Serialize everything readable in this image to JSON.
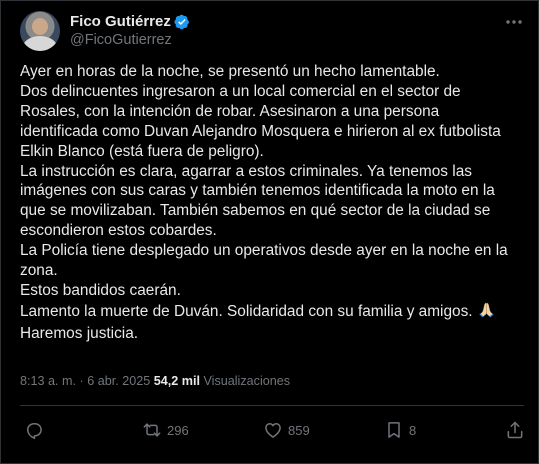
{
  "author": {
    "display_name": "Fico Gutiérrez",
    "handle": "@FicoGutierrez",
    "verified": true,
    "avatar_description": "profile photo"
  },
  "tweet": {
    "text": "Ayer en horas de la noche, se presentó un hecho lamentable.\nDos delincuentes ingresaron a un local comercial en el sector de\nRosales, con la intención de robar. Asesinaron a una persona\nidentificada como Duvan Alejandro Mosquera e hirieron al ex futbolista\nElkin Blanco (está fuera de peligro).\nLa instrucción es clara, agarrar a estos criminales. Ya tenemos las\nimágenes con sus caras y también tenemos identificada la moto en la\nque se movilizaban. También sabemos en qué sector de la ciudad se\nescondieron estos cobardes.\nLa Policía tiene desplegado un operativos desde ayer en la noche en la\nzona.\nEstos bandidos caerán.\nLamento la muerte de Duván. Solidaridad con su familia y amigos.",
    "text_last_line": "Haremos justicia.",
    "emoji": "🙏🏻"
  },
  "meta": {
    "time": "8:13 a. m.",
    "separator": "·",
    "date": "6 abr. 2025",
    "views_count": "54,2 mil",
    "views_label": "Visualizaciones"
  },
  "actions": {
    "reply_count": "",
    "retweet_count": "296",
    "like_count": "859",
    "bookmark_count": "8"
  },
  "icons": {
    "verified": "verified-badge-icon",
    "more": "more-horizontal-icon",
    "reply": "reply-icon",
    "retweet": "retweet-icon",
    "like": "heart-icon",
    "bookmark": "bookmark-icon",
    "share": "share-icon"
  },
  "colors": {
    "background": "#000000",
    "text": "#e7e9ea",
    "secondary": "#71767b",
    "verified_blue": "#1d9bf0",
    "divider": "#2f3336"
  }
}
